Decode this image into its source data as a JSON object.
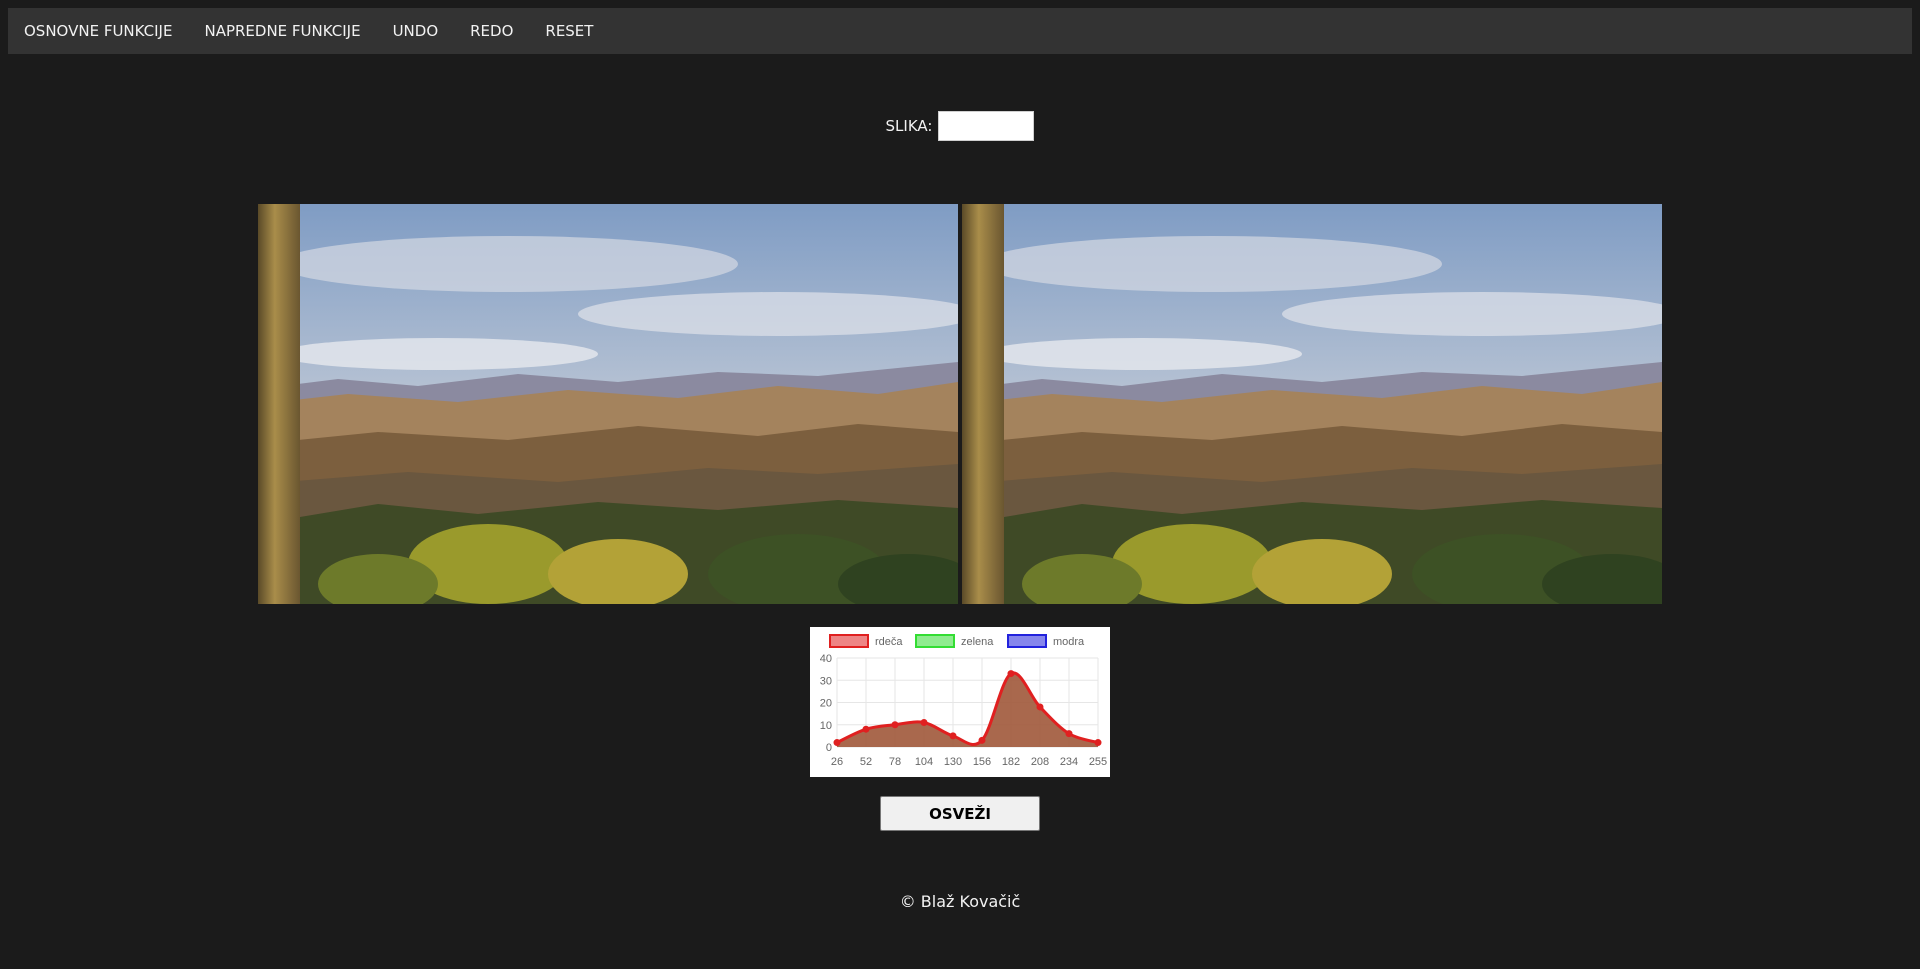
{
  "nav": {
    "items": [
      "OSNOVNE FUNKCIJE",
      "NAPREDNE FUNKCIJE",
      "UNDO",
      "REDO",
      "RESET"
    ]
  },
  "image_input": {
    "label": "SLIKA:",
    "value": ""
  },
  "button": {
    "refresh_label": "OSVEŽI"
  },
  "footer": {
    "text": "© Blaž Kovačič"
  },
  "colors": {
    "page_bg": "#1b1b1b",
    "nav_bg": "#333333",
    "series_red": "#e02020",
    "series_fill": "#a0583a"
  },
  "chart_data": {
    "type": "line",
    "x": [
      "26",
      "52",
      "78",
      "104",
      "130",
      "156",
      "182",
      "208",
      "234",
      "255"
    ],
    "series": [
      {
        "name": "rdeča",
        "values": [
          2,
          8,
          10,
          11,
          5,
          3,
          33,
          18,
          6,
          2
        ],
        "color": "#e02020"
      },
      {
        "name": "zelena",
        "values": [],
        "color": "#33dd33"
      },
      {
        "name": "modra",
        "values": [],
        "color": "#2222dd"
      }
    ],
    "ylim": [
      0,
      40
    ],
    "yticks": [
      0,
      10,
      20,
      30,
      40
    ],
    "grid": true,
    "legend": "top",
    "fill": true
  }
}
